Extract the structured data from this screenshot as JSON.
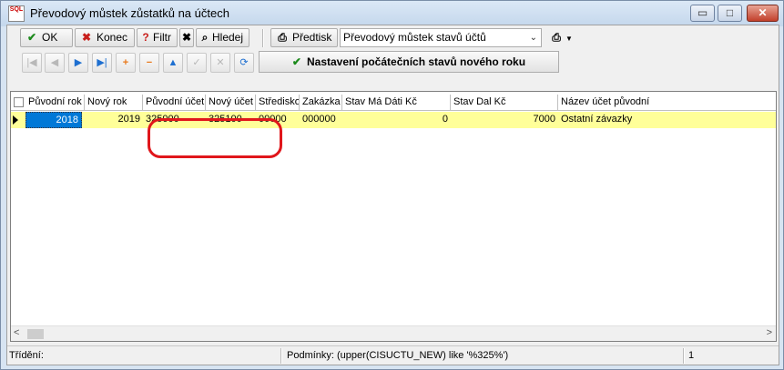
{
  "window": {
    "title": "Převodový můstek zůstatků na účtech",
    "app_icon": "SQL",
    "controls": {
      "minimize": "▭",
      "maximize": "□",
      "close": "✕"
    }
  },
  "toolbar": {
    "ok_label": "OK",
    "konec_label": "Konec",
    "filtr_label": "Filtr",
    "hledej_label": "Hledej",
    "predtisk_label": "Předtisk",
    "report_combo_value": "Převodový můstek stavů účtů",
    "setup_button_label": "Nastavení počátečních stavů nového roku"
  },
  "grid": {
    "columns": [
      "Původní rok",
      "Nový rok",
      "Původní účet",
      "Nový účet",
      "Středisko",
      "Zakázka",
      "Stav Má Dáti Kč",
      "Stav Dal Kč",
      "Název účet původní"
    ],
    "rows": [
      {
        "puvodni_rok": "2018",
        "novy_rok": "2019",
        "puvodni_ucet": "325000",
        "novy_ucet": "325100",
        "stredisko": "00000",
        "zakazka": "000000",
        "stav_ma_dati": "0",
        "stav_dal": "7000",
        "nazev": "Ostatní závazky"
      }
    ]
  },
  "status": {
    "trideni": "Třídění:",
    "podminky": "Podmínky: (upper(CISUCTU_NEW) like '%325%')",
    "count": "1"
  },
  "colors": {
    "selected_row": "#ffff99",
    "selected_cell": "#0078d7",
    "annotation": "#e0161b"
  }
}
